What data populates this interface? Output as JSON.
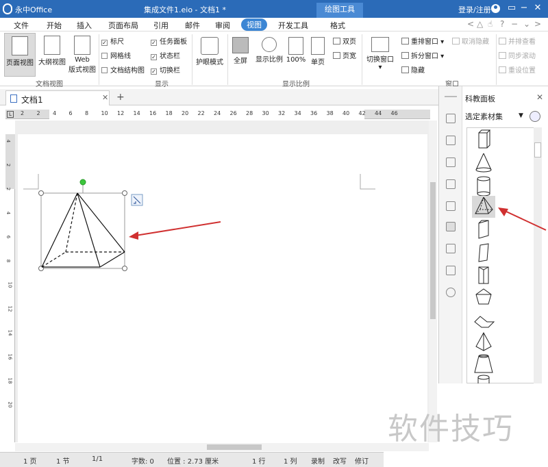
{
  "titlebar": {
    "app_name": "永中Office",
    "doc_title": "集成文件1.eio - 文档1 *",
    "tool_tab": "绘图工具",
    "login": "登录/注册",
    "colors": {
      "bar": "#2b6bb8",
      "tool_tab": "#4a8ad4"
    }
  },
  "menu": {
    "items": [
      "文件",
      "开始",
      "插入",
      "页面布局",
      "引用",
      "邮件",
      "审阅",
      "视图",
      "开发工具",
      "格式"
    ],
    "active": "视图"
  },
  "ribbon": {
    "doc_view": {
      "page_view": "页面视图",
      "outline_view": "大纲视图",
      "web_view_1": "Web",
      "web_view_2": "版式视图",
      "group": "文档视图"
    },
    "show": {
      "ruler": "标尺",
      "gridlines": "网格线",
      "doc_map": "文档结构图",
      "task_pane": "任务面板",
      "status_bar": "状态栏",
      "switch_bar": "切换栏",
      "group": "显示",
      "checked": {
        "ruler": true,
        "gridlines": false,
        "doc_map": false,
        "task_pane": true,
        "status_bar": true,
        "switch_bar": true
      }
    },
    "eye_mode": "护眼模式",
    "zoom": {
      "full_screen": "全屏",
      "zoom_ratio": "显示比例",
      "hundred": "100%",
      "single_page": "单页",
      "double_page": "双页",
      "page_width": "页宽",
      "group": "显示比例"
    },
    "window": {
      "switch_window": "切换窗口",
      "rearrange": "重排窗口",
      "split": "拆分窗口",
      "hide": "隐藏",
      "unhide": "取消隐藏",
      "side_by_side": "并排查看",
      "sync_scroll": "同步滚动",
      "reset_pos": "重设位置",
      "group": "窗口"
    }
  },
  "tabs": {
    "doc_tab": "文档1"
  },
  "ruler": {
    "h_numbers": [
      "2",
      "2",
      "4",
      "6",
      "8",
      "10",
      "12",
      "14",
      "16",
      "18",
      "20",
      "22",
      "24",
      "26",
      "28",
      "30",
      "32",
      "34",
      "36",
      "38",
      "40",
      "42",
      "44",
      "46"
    ],
    "v_numbers": [
      "4",
      "2",
      "2",
      "4",
      "6",
      "8",
      "10",
      "12",
      "14",
      "16",
      "18",
      "20"
    ]
  },
  "status": {
    "page": "1 页",
    "section": "1 节",
    "pages": "1/1",
    "words": "字数: 0",
    "position": "位置 : 2.73 厘米",
    "row": "1 行",
    "col": "1 列",
    "record": "录制",
    "rewrite": "改写",
    "revise": "修订"
  },
  "panel": {
    "title": "科教面板",
    "select": "选定素材集"
  },
  "annotation_color": "#d03030",
  "watermark": "软件技巧"
}
